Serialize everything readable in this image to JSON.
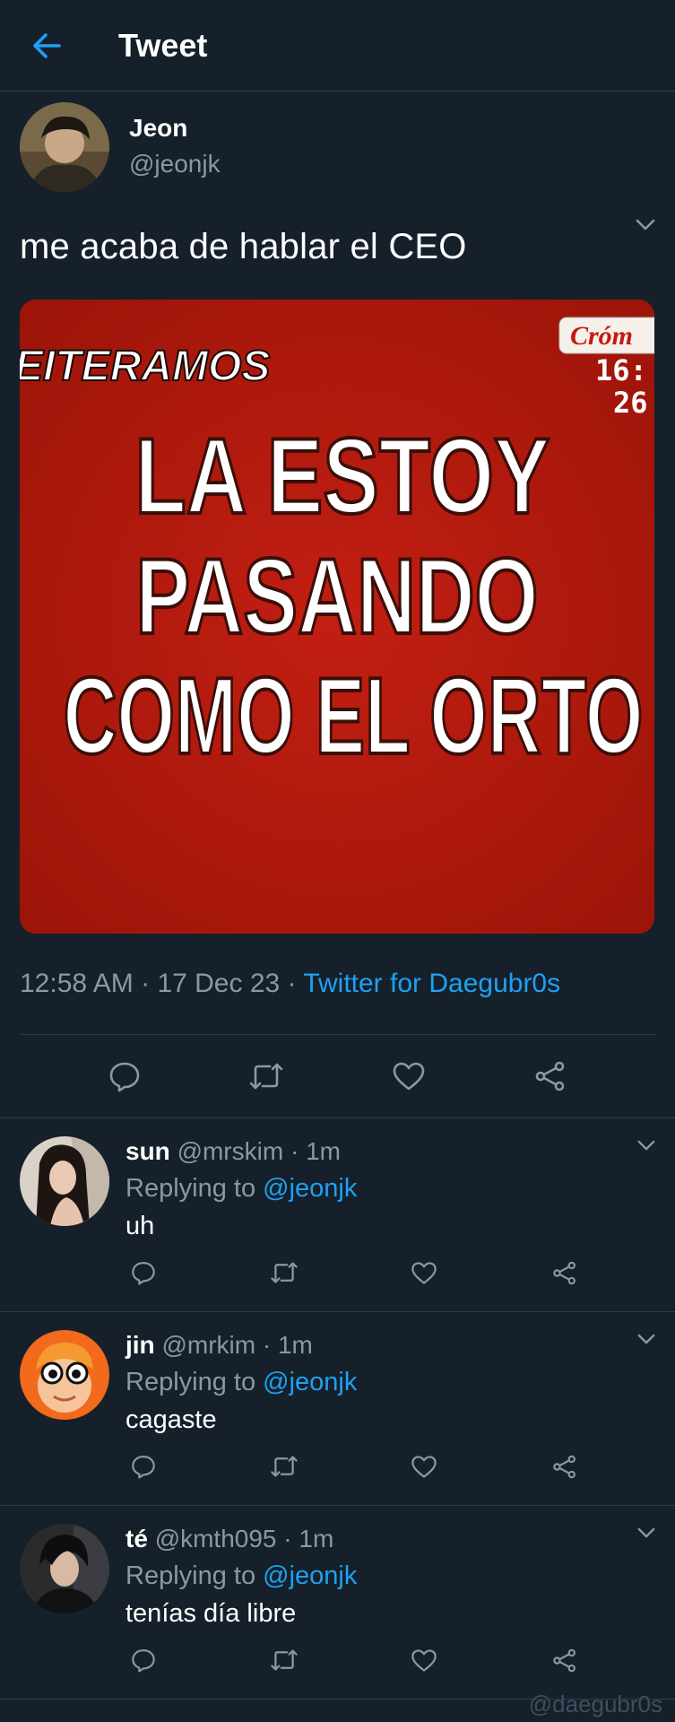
{
  "header": {
    "title": "Tweet",
    "back_icon": "arrow-left-icon"
  },
  "main_tweet": {
    "author_name": "Jeon",
    "author_handle": "@jeonjk",
    "text": "me acaba de hablar el CEO",
    "media": {
      "top_left_text": "EITERAMOS",
      "brand": "Cróm",
      "clock_line1": "16:",
      "clock_line2": "26",
      "headline_line1": "LA ESTOY",
      "headline_line2": "PASANDO",
      "headline_line3": "COMO EL ORTO"
    },
    "time": "12:58 AM",
    "sep1": " · ",
    "date": "17 Dec 23",
    "sep2": " · ",
    "source": "Twitter for Daegubr0s"
  },
  "colors": {
    "background": "#15202b",
    "accent": "#1da1f2",
    "muted": "#8899a6",
    "divider": "#2f3b47",
    "media_red": "#b31a10"
  },
  "replies": [
    {
      "name": "sun",
      "handle": "@mrskim",
      "time": "1m",
      "replying_prefix": "Replying to ",
      "replying_to": "@jeonjk",
      "text": "uh"
    },
    {
      "name": "jin",
      "handle": "@mrkim",
      "time": "1m",
      "replying_prefix": "Replying to ",
      "replying_to": "@jeonjk",
      "text": "cagaste"
    },
    {
      "name": "té",
      "handle": "@kmth095",
      "time": "1m",
      "replying_prefix": "Replying to ",
      "replying_to": "@jeonjk",
      "text": "tenías día libre"
    }
  ],
  "dot": " · ",
  "watermark": "@daegubr0s"
}
